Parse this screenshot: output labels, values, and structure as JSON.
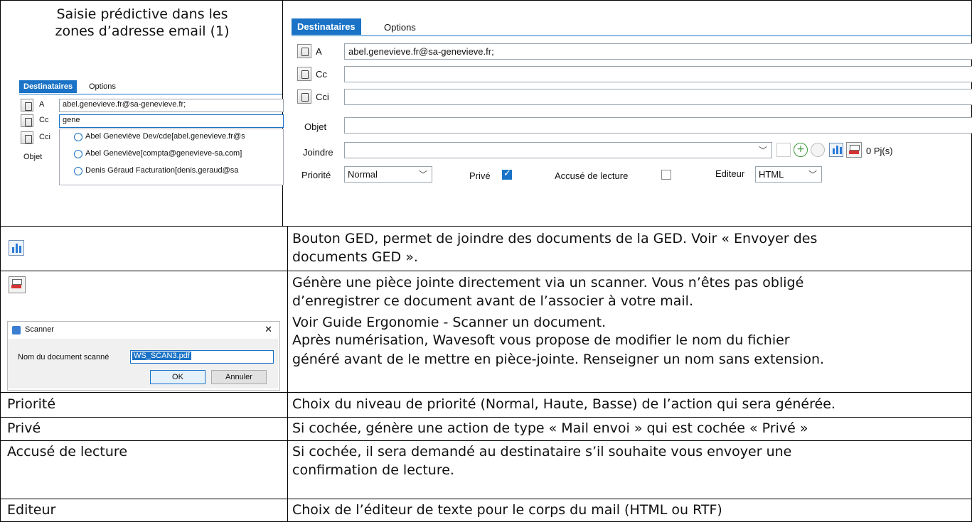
{
  "header_cell": {
    "title_line1": "Saisie prédictive dans les",
    "title_line2": "zones d’adresse email (1)"
  },
  "small_form": {
    "tab_active": "Destinataires",
    "tab_other": "Options",
    "label_a": "A",
    "label_cc": "Cc",
    "label_cci": "Cci",
    "label_objet": "Objet",
    "value_a": "abel.genevieve.fr@sa-genevieve.fr;",
    "value_cc": "gene",
    "suggestions": [
      "Abel Geneviève Dev/cde[abel.genevieve.fr@s",
      "Abel Geneviève[compta@genevieve-sa.com]",
      "Denis Géraud Facturation[denis.geraud@sa"
    ]
  },
  "big_form": {
    "tab_active": "Destinataires",
    "tab_other": "Options",
    "label_a": "A",
    "label_cc": "Cc",
    "label_cci": "Cci",
    "label_objet": "Objet",
    "label_joindre": "Joindre",
    "value_a": "abel.genevieve.fr@sa-genevieve.fr;",
    "pj_count": "0 Pj(s)",
    "label_priorite": "Priorité",
    "priorite_value": "Normal",
    "label_prive": "Privé",
    "label_accuse": "Accusé de lecture",
    "label_editeur": "Editeur",
    "editeur_value": "HTML"
  },
  "rows": {
    "ged_desc_1": "Bouton GED, permet de joindre des documents de la GED. Voir « Envoyer des",
    "ged_desc_2": "documents GED ».",
    "scan_desc": [
      "Génère une pièce jointe directement via un scanner. Vous n’êtes pas obligé",
      "d’enregistrer ce document avant de l’associer à votre mail.",
      "Voir Guide Ergonomie - Scanner un document.",
      "Après numérisation, Wavesoft vous propose de modifier le nom du fichier",
      "généré avant de le mettre en pièce-jointe. Renseigner un nom sans extension."
    ],
    "priorite_label": "Priorité",
    "priorite_desc": "Choix du niveau de priorité (Normal, Haute, Basse) de l’action qui sera générée.",
    "prive_label": "Privé",
    "prive_desc": "Si cochée, génère une action de type « Mail envoi » qui est cochée « Privé »",
    "accuse_label": "Accusé de lecture",
    "accuse_desc_1": "Si cochée, il sera demandé au destinataire s’il souhaite vous envoyer une",
    "accuse_desc_2": "confirmation de lecture.",
    "editeur_label": "Editeur",
    "editeur_desc": "Choix de l’éditeur de texte pour le corps du mail (HTML ou RTF)"
  },
  "scanner_dialog": {
    "title": "Scanner",
    "close": "✕",
    "field_label": "Nom du document scanné",
    "field_value": "WS_SCAN3.pdf",
    "ok": "OK",
    "cancel": "Annuler"
  },
  "colors": {
    "accent": "#1a73c6",
    "border": "#000000"
  }
}
